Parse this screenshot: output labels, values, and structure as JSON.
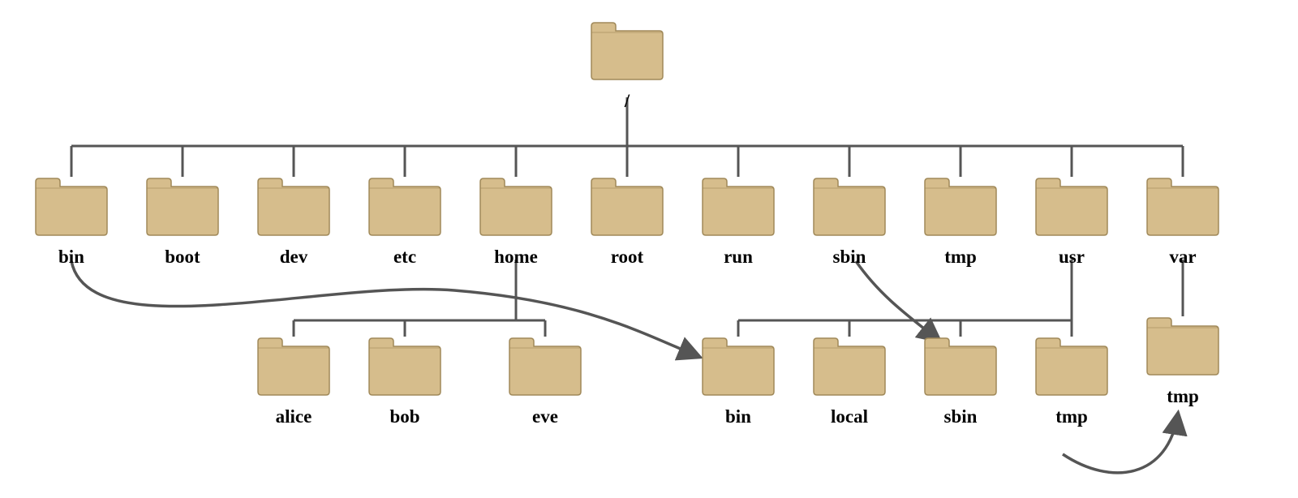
{
  "diagram": {
    "type": "filesystem-tree",
    "folder_color_fill": "#d6bd8c",
    "folder_color_stroke": "#a08959",
    "connector_color": "#555555",
    "root": {
      "label": "/"
    },
    "level1": [
      {
        "id": "bin",
        "label": "bin"
      },
      {
        "id": "boot",
        "label": "boot"
      },
      {
        "id": "dev",
        "label": "dev"
      },
      {
        "id": "etc",
        "label": "etc"
      },
      {
        "id": "home",
        "label": "home"
      },
      {
        "id": "root",
        "label": "root"
      },
      {
        "id": "run",
        "label": "run"
      },
      {
        "id": "sbin",
        "label": "sbin"
      },
      {
        "id": "tmp",
        "label": "tmp"
      },
      {
        "id": "usr",
        "label": "usr"
      },
      {
        "id": "var",
        "label": "var"
      }
    ],
    "home_children": [
      {
        "id": "alice",
        "label": "alice"
      },
      {
        "id": "bob",
        "label": "bob"
      },
      {
        "id": "eve",
        "label": "eve"
      }
    ],
    "usr_children": [
      {
        "id": "usr-bin",
        "label": "bin"
      },
      {
        "id": "usr-local",
        "label": "local"
      },
      {
        "id": "usr-sbin",
        "label": "sbin"
      },
      {
        "id": "usr-tmp",
        "label": "tmp"
      }
    ],
    "var_children": [
      {
        "id": "var-tmp",
        "label": "tmp"
      }
    ],
    "symlinks": [
      {
        "from": "bin",
        "to": "usr-bin"
      },
      {
        "from": "sbin",
        "to": "usr-sbin"
      },
      {
        "from": "var-tmp",
        "to": "usr-tmp"
      }
    ]
  }
}
